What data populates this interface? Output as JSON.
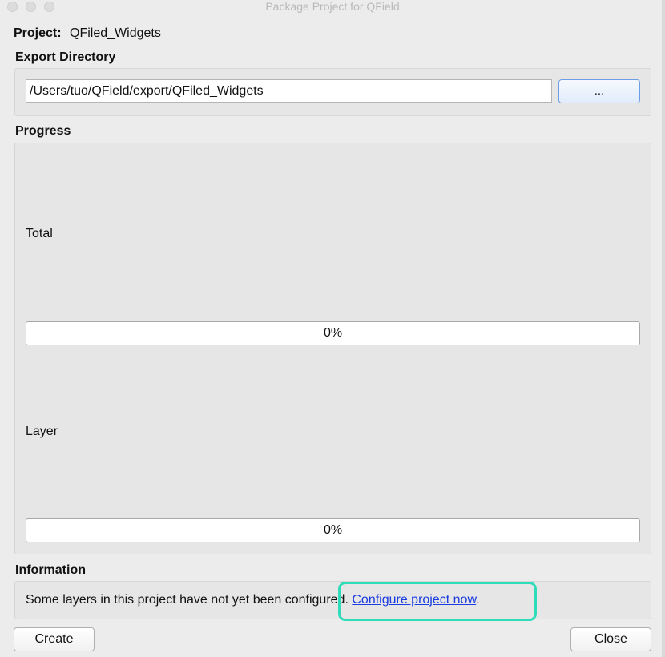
{
  "window": {
    "title": "Package Project for QField"
  },
  "project": {
    "label": "Project:",
    "value": "QFiled_Widgets"
  },
  "export_directory": {
    "title": "Export Directory",
    "path": "/Users/tuo/QField/export/QFiled_Widgets",
    "browse_label": "..."
  },
  "progress": {
    "title": "Progress",
    "total": {
      "label": "Total",
      "value": 0,
      "text": "0%"
    },
    "layer": {
      "label": "Layer",
      "value": 0,
      "text": "0%"
    }
  },
  "information": {
    "title": "Information",
    "message": "Some layers in this project have not yet been configured.",
    "link_text": "Configure project now",
    "suffix": "."
  },
  "buttons": {
    "create": "Create",
    "close": "Close"
  },
  "colors": {
    "highlight": "#2fdcb9",
    "link": "#1a3ce0"
  }
}
